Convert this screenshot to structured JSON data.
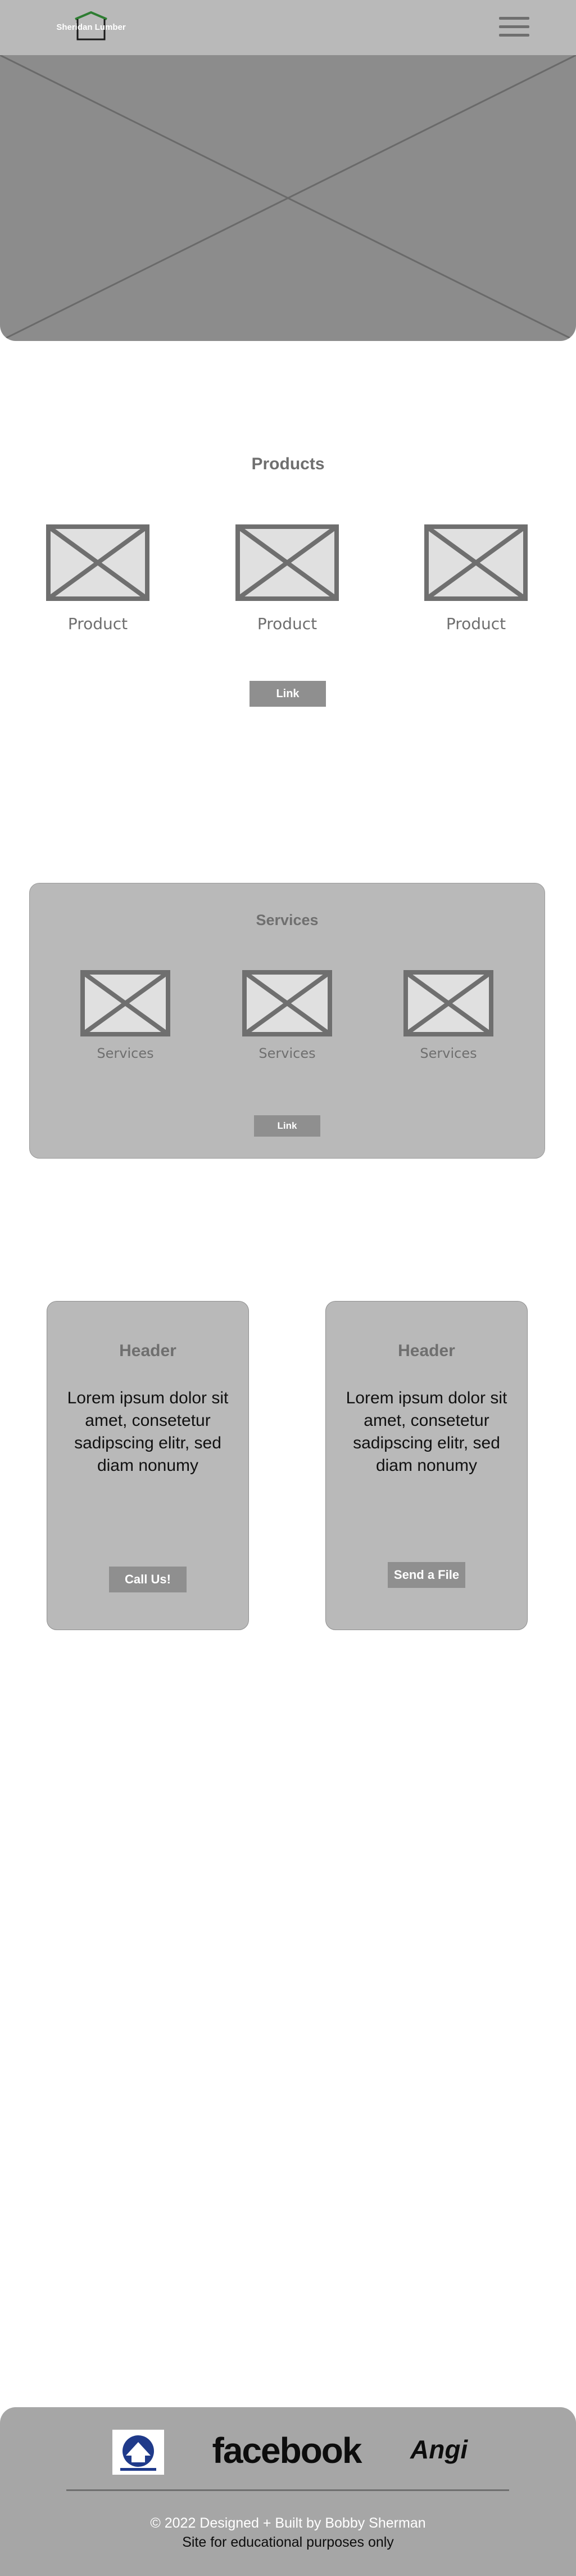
{
  "header": {
    "logo_text": "Sheridan Lumber",
    "menu_icon": "hamburger-menu-icon"
  },
  "hero": {
    "image_icon": "image-placeholder-icon"
  },
  "products": {
    "title": "Products",
    "items": [
      {
        "label": "Product",
        "icon": "image-placeholder-icon"
      },
      {
        "label": "Product",
        "icon": "image-placeholder-icon"
      },
      {
        "label": "Product",
        "icon": "image-placeholder-icon"
      }
    ],
    "link_label": "Link"
  },
  "services": {
    "title": "Services",
    "items": [
      {
        "label": "Services",
        "icon": "image-placeholder-icon"
      },
      {
        "label": "Services",
        "icon": "image-placeholder-icon"
      },
      {
        "label": "Services",
        "icon": "image-placeholder-icon"
      }
    ],
    "link_label": "Link"
  },
  "cta": [
    {
      "header": "Header",
      "body": "Lorem ipsum dolor sit amet, consetetur sadipscing elitr, sed diam nonumy",
      "button_label": "Call Us!"
    },
    {
      "header": "Header",
      "body": "Lorem ipsum dolor sit amet, consetetur sadipscing elitr, sed diam nonumy",
      "button_label": "Send a File"
    }
  ],
  "footer": {
    "badge_icon": "accreditation-badge-icon",
    "facebook_label": "facebook",
    "angi_label": "Angi",
    "copyright": "© 2022 Designed + Built by Bobby Sherman",
    "note": "Site for educational purposes only"
  },
  "colors": {
    "header_bg": "#b9b9b9",
    "hero_bg": "#8c8c8c",
    "card_bg": "#b9b9b9",
    "button_bg": "#8f8f8f",
    "footer_bg": "#a6a6a6",
    "logo_accent": "#2e7d32"
  }
}
